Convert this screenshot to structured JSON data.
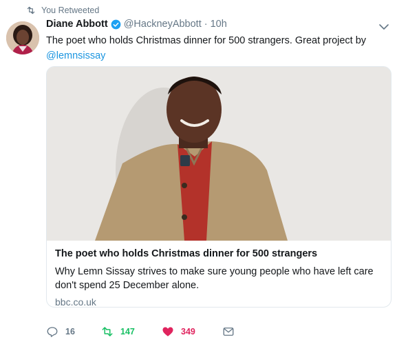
{
  "retweet_label": "You Retweeted",
  "author": {
    "name": "Diane Abbott",
    "handle": "@HackneyAbbott",
    "separator": "·",
    "time": "10h"
  },
  "tweet": {
    "text": "The poet who holds Christmas dinner for 500 strangers. Great project by",
    "mention": "@lemnsissay"
  },
  "card": {
    "title": "The poet who holds Christmas dinner for 500 strangers",
    "description": "Why Lemn Sissay strives to make sure young people who have left care don't spend 25 December alone.",
    "domain": "bbc.co.uk"
  },
  "actions": {
    "replies": "16",
    "retweets": "147",
    "likes": "349"
  },
  "colors": {
    "retweet_active": "#17bf63",
    "like_active": "#e0245e",
    "link": "#1b95e0",
    "verified": "#1da1f2"
  },
  "icons": {
    "retweet": "retweet-icon",
    "verified": "verified-badge-icon",
    "caret": "chevron-down-icon",
    "reply": "reply-icon",
    "like": "heart-icon",
    "message": "envelope-icon"
  }
}
